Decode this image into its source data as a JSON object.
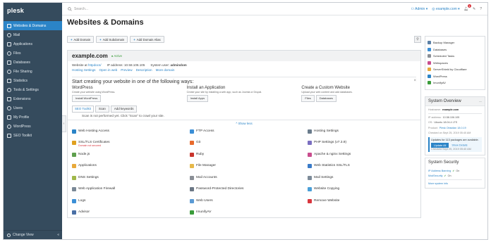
{
  "app": {
    "logo": "plesk"
  },
  "sidebar": {
    "items": [
      {
        "label": "Websites & Domains",
        "icon": "websites-icon",
        "active": true
      },
      {
        "label": "Mail",
        "icon": "mail-icon"
      },
      {
        "label": "Applications",
        "icon": "applications-icon"
      },
      {
        "label": "Files",
        "icon": "files-icon"
      },
      {
        "label": "Databases",
        "icon": "databases-icon"
      },
      {
        "label": "File Sharing",
        "icon": "file-sharing-icon"
      },
      {
        "label": "Statistics",
        "icon": "statistics-icon"
      },
      {
        "label": "Tools & Settings",
        "icon": "tools-icon"
      },
      {
        "label": "Extensions",
        "icon": "extensions-icon"
      },
      {
        "label": "Users",
        "icon": "users-icon"
      },
      {
        "label": "My Profile",
        "icon": "profile-icon"
      },
      {
        "label": "WordPress",
        "icon": "wordpress-icon"
      },
      {
        "label": "SEO Toolkit",
        "icon": "seo-icon"
      }
    ],
    "change_view": "Change View"
  },
  "topbar": {
    "search_placeholder": "Search...",
    "user": "Admin",
    "domain": "example.com",
    "notif_count": "1"
  },
  "page": {
    "title": "Websites & Domains"
  },
  "toolbar": {
    "add_domain": "Add Domain",
    "add_subdomain": "Add Subdomain",
    "add_alias": "Add Domain Alias"
  },
  "domain": {
    "name": "example.com",
    "status": "Active",
    "website_at_label": "Website at",
    "website_at_value": "httpdocs/",
    "ip_label": "IP address:",
    "ip_value": "10.58.106.105",
    "sysuser_label": "System user:",
    "sysuser_value": "admindom",
    "links": [
      "Hosting Settings",
      "Open in web",
      "Preview",
      "Description",
      "More domain"
    ]
  },
  "start": {
    "title": "Start creating your website in one of the following ways:",
    "cols": [
      {
        "title": "WordPress",
        "desc": "Create your website using WordPress.",
        "buttons": [
          "Install WordPress"
        ]
      },
      {
        "title": "Install an Application",
        "desc": "Create your site by installing a web app, such as Joomla or Drupal.",
        "buttons": [
          "Install Apps"
        ]
      },
      {
        "title": "Create a Custom Website",
        "desc": "Upload your web content and add databases.",
        "buttons": [
          "Files",
          "Databases"
        ]
      }
    ]
  },
  "seo": {
    "tag": "SEO Toolkit",
    "scan": "Scan",
    "add_keywords": "Add keywords",
    "message": "Scan is not performed yet. Click \"Scan\" to crawl your site."
  },
  "show_less": "^ Show less",
  "tools": [
    {
      "label": "Web Hosting Access",
      "color": "#2b84c7"
    },
    {
      "label": "FTP Access",
      "color": "#3b8fd6"
    },
    {
      "label": "Hosting Settings",
      "color": "#6a7c8c"
    },
    {
      "label": "SSL/TLS Certificates",
      "color": "#e0a020",
      "sub": "Domain not secured"
    },
    {
      "label": "Git",
      "color": "#e86a2c"
    },
    {
      "label": "PHP Settings (v7.3.9)",
      "color": "#7b6fc1"
    },
    {
      "label": "Node.js",
      "color": "#5fa04e"
    },
    {
      "label": "Ruby",
      "color": "#c9352c"
    },
    {
      "label": "Apache & nginx Settings",
      "color": "#c94d8e"
    },
    {
      "label": "Applications",
      "color": "#e8a93a"
    },
    {
      "label": "File Manager",
      "color": "#e6b84a"
    },
    {
      "label": "Web Statistics SSL/TLS",
      "color": "#3a7bc8"
    },
    {
      "label": "DNS Settings",
      "color": "#a0b84a"
    },
    {
      "label": "Mail Accounts",
      "color": "#8a8f96"
    },
    {
      "label": "Mail Settings",
      "color": "#7d8b99"
    },
    {
      "label": "Web Application Firewall",
      "color": "#7a8896"
    },
    {
      "label": "Password-Protected Directories",
      "color": "#6b7785"
    },
    {
      "label": "Website Copying",
      "color": "#4a9fd8"
    },
    {
      "label": "Logs",
      "color": "#3b8fd6"
    },
    {
      "label": "Web Users",
      "color": "#5b9bd5"
    },
    {
      "label": "Remove Website",
      "color": "#d9363e"
    },
    {
      "label": "Advisor",
      "color": "#4a6fa5"
    },
    {
      "label": "ImunifyAV",
      "color": "#3a9c3a"
    }
  ],
  "right_links": [
    {
      "label": "Backup Manager",
      "color": "#5b7fa5"
    },
    {
      "label": "Databases",
      "color": "#3b8fd6"
    },
    {
      "label": "Scheduled Tasks",
      "color": "#8a8f96"
    },
    {
      "label": "Webspaces",
      "color": "#c94d8e"
    },
    {
      "label": "ServerShield by Cloudflare",
      "color": "#e8a93a"
    },
    {
      "label": "WordPress",
      "color": "#2b84c7"
    },
    {
      "label": "ImunifyAV",
      "color": "#3a9c3a"
    }
  ],
  "overview": {
    "title": "System Overview",
    "hostname_label": "Hostname:",
    "hostname_value": "example.com",
    "ip_label": "IP address:",
    "ip_value": "10.58.106.105",
    "os_label": "OS:",
    "os_value": "Ubuntu 18.04.4 LTS",
    "product_label": "Product:",
    "product_value": "Plesk Obsidian 18.0.19",
    "checked": "Checked on Sept 25, 2019 05:40 AM",
    "updates": "Updates for 113 packages are available.",
    "update_all": "Update All",
    "show_details": "Show Details",
    "updates_checked": "Checked Sept 25, 2019 05:40 AM"
  },
  "security": {
    "title": "System Security",
    "ip_ban_label": "IP Address Banning",
    "ip_ban_state": "On",
    "modsec_label": "ModSecurity",
    "modsec_state": "On",
    "more_info": "More system info"
  }
}
